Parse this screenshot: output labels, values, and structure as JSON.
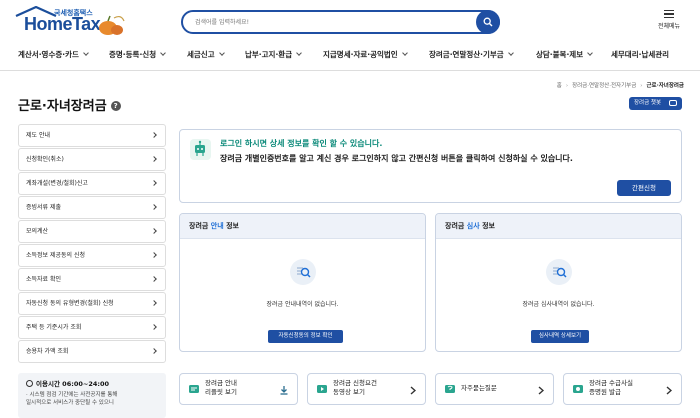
{
  "header": {
    "logo_kr": "국세청홈택스",
    "logo_en": "HomeTax",
    "search_placeholder": "검색어를 입력하세요!",
    "all_menu_label": "전체메뉴"
  },
  "gnb": [
    {
      "label": "계산서·영수증·카드"
    },
    {
      "label": "증명·등록·신청"
    },
    {
      "label": "세금신고"
    },
    {
      "label": "납부·고지·환급"
    },
    {
      "label": "지급명세·자료·공익법인"
    },
    {
      "label": "장려금·연말정산·기부금"
    },
    {
      "label": "상담·불복·제보"
    },
    {
      "label": "세무대리·납세관리"
    }
  ],
  "breadcrumb": {
    "home": "홈",
    "level1": "장려금·연말정산·전자기부금",
    "current": "근로·자녀장려금",
    "sep": "›"
  },
  "page": {
    "title": "근로·자녀장려금",
    "help": "?",
    "chatbot": "장려금 챗봇"
  },
  "sidebar": [
    {
      "label": "제도 안내"
    },
    {
      "label": "신청확인(취소)"
    },
    {
      "label": "계좌개설(변경/철회)신고"
    },
    {
      "label": "증빙서류 제출"
    },
    {
      "label": "모의계산"
    },
    {
      "label": "소득정보 제공동의 신청"
    },
    {
      "label": "소득자료 확인"
    },
    {
      "label": "자동신청 동의 유형변경(철회) 신청"
    },
    {
      "label": "주택 등 기준시가 조회"
    },
    {
      "label": "승용차 가액 조회"
    }
  ],
  "hours": {
    "title": "이용시간 06:00~24:00",
    "line1": "· 시스템 점검 기간에는 사전공지를 통해",
    "line2": "일시적으로 서비스가 중단될 수 있으니"
  },
  "login_notice": {
    "line1": "로그인 하시면 상세 정보를 확인 할 수 있습니다.",
    "line2": "장려금 개별인증번호를 알고 계신 경우 로그인하지 않고 간편신청 버튼을 클릭하여 신청하실 수 있습니다.",
    "button": "간편신청"
  },
  "panels": [
    {
      "title_hl": "안내",
      "title_pre": "장려금 ",
      "title_post": " 정보",
      "empty": "장려금 안내내역이 없습니다.",
      "button": "자동신청동의 정보 확인"
    },
    {
      "title_hl": "심사",
      "title_pre": "장려금 ",
      "title_post": " 정보",
      "empty": "장려금 심사내역이 없습니다.",
      "button": "심사내역 상세보기"
    }
  ],
  "quick_links": [
    {
      "line1": "장려금 안내",
      "line2": "리플릿 보기",
      "icon": "download-icon"
    },
    {
      "line1": "장려금 신청요건",
      "line2": "동영상 보기",
      "icon": "chevron-right-icon"
    },
    {
      "line1": "자주묻는질문",
      "line2": "",
      "icon": "chevron-right-icon"
    },
    {
      "line1": "장려금 수급사실",
      "line2": "증명원 발급",
      "icon": "chevron-right-icon"
    }
  ],
  "colors": {
    "primary": "#1f4fa3",
    "accent_green": "#0c8a7a",
    "highlight_blue": "#1f6fd6"
  }
}
